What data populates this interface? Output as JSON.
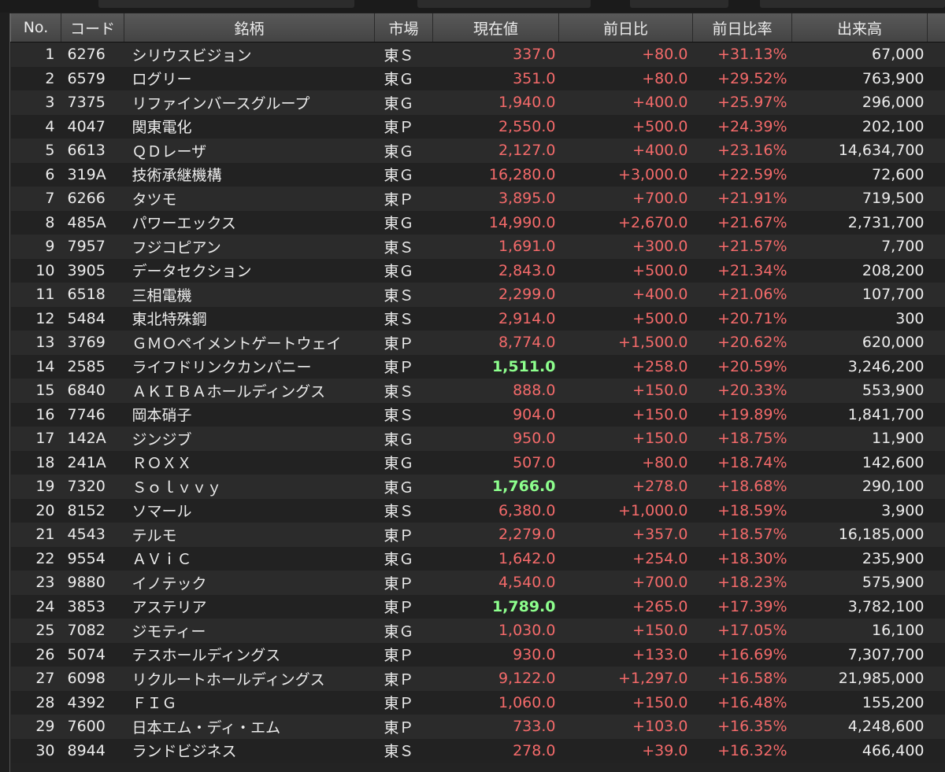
{
  "colors": {
    "up": "#f46a6a",
    "highlight_green": "#8dff8d",
    "text": "#ececec"
  },
  "table": {
    "headers": [
      "No.",
      "コード",
      "銘柄",
      "市場",
      "現在値",
      "前日比",
      "前日比率",
      "出来高"
    ],
    "rows": [
      {
        "no": "1",
        "code": "6276",
        "name": "シリウスビジョン",
        "market": "東Ｓ",
        "price": "337.0",
        "change": "+80.0",
        "pct": "+31.13%",
        "volume": "67,000",
        "price_color": "red"
      },
      {
        "no": "2",
        "code": "6579",
        "name": "ログリー",
        "market": "東Ｇ",
        "price": "351.0",
        "change": "+80.0",
        "pct": "+29.52%",
        "volume": "763,900",
        "price_color": "red"
      },
      {
        "no": "3",
        "code": "7375",
        "name": "リファインバースグループ",
        "market": "東Ｇ",
        "price": "1,940.0",
        "change": "+400.0",
        "pct": "+25.97%",
        "volume": "296,000",
        "price_color": "red"
      },
      {
        "no": "4",
        "code": "4047",
        "name": "関東電化",
        "market": "東Ｐ",
        "price": "2,550.0",
        "change": "+500.0",
        "pct": "+24.39%",
        "volume": "202,100",
        "price_color": "red"
      },
      {
        "no": "5",
        "code": "6613",
        "name": "ＱＤレーザ",
        "market": "東Ｇ",
        "price": "2,127.0",
        "change": "+400.0",
        "pct": "+23.16%",
        "volume": "14,634,700",
        "price_color": "red"
      },
      {
        "no": "6",
        "code": "319A",
        "name": "技術承継機構",
        "market": "東Ｇ",
        "price": "16,280.0",
        "change": "+3,000.0",
        "pct": "+22.59%",
        "volume": "72,600",
        "price_color": "red"
      },
      {
        "no": "7",
        "code": "6266",
        "name": "タツモ",
        "market": "東Ｐ",
        "price": "3,895.0",
        "change": "+700.0",
        "pct": "+21.91%",
        "volume": "719,500",
        "price_color": "red"
      },
      {
        "no": "8",
        "code": "485A",
        "name": "パワーエックス",
        "market": "東Ｇ",
        "price": "14,990.0",
        "change": "+2,670.0",
        "pct": "+21.67%",
        "volume": "2,731,700",
        "price_color": "red"
      },
      {
        "no": "9",
        "code": "7957",
        "name": "フジコピアン",
        "market": "東Ｓ",
        "price": "1,691.0",
        "change": "+300.0",
        "pct": "+21.57%",
        "volume": "7,700",
        "price_color": "red"
      },
      {
        "no": "10",
        "code": "3905",
        "name": "データセクション",
        "market": "東Ｇ",
        "price": "2,843.0",
        "change": "+500.0",
        "pct": "+21.34%",
        "volume": "208,200",
        "price_color": "red"
      },
      {
        "no": "11",
        "code": "6518",
        "name": "三相電機",
        "market": "東Ｓ",
        "price": "2,299.0",
        "change": "+400.0",
        "pct": "+21.06%",
        "volume": "107,700",
        "price_color": "red"
      },
      {
        "no": "12",
        "code": "5484",
        "name": "東北特殊鋼",
        "market": "東Ｓ",
        "price": "2,914.0",
        "change": "+500.0",
        "pct": "+20.71%",
        "volume": "300",
        "price_color": "red"
      },
      {
        "no": "13",
        "code": "3769",
        "name": "ＧＭＯペイメントゲートウェイ",
        "market": "東Ｐ",
        "price": "8,774.0",
        "change": "+1,500.0",
        "pct": "+20.62%",
        "volume": "620,000",
        "price_color": "red"
      },
      {
        "no": "14",
        "code": "2585",
        "name": "ライフドリンクカンパニー",
        "market": "東Ｐ",
        "price": "1,511.0",
        "change": "+258.0",
        "pct": "+20.59%",
        "volume": "3,246,200",
        "price_color": "green"
      },
      {
        "no": "15",
        "code": "6840",
        "name": "ＡＫＩＢＡホールディングス",
        "market": "東Ｓ",
        "price": "888.0",
        "change": "+150.0",
        "pct": "+20.33%",
        "volume": "553,900",
        "price_color": "red"
      },
      {
        "no": "16",
        "code": "7746",
        "name": "岡本硝子",
        "market": "東Ｓ",
        "price": "904.0",
        "change": "+150.0",
        "pct": "+19.89%",
        "volume": "1,841,700",
        "price_color": "red"
      },
      {
        "no": "17",
        "code": "142A",
        "name": "ジンジブ",
        "market": "東Ｇ",
        "price": "950.0",
        "change": "+150.0",
        "pct": "+18.75%",
        "volume": "11,900",
        "price_color": "red"
      },
      {
        "no": "18",
        "code": "241A",
        "name": "ＲＯＸＸ",
        "market": "東Ｇ",
        "price": "507.0",
        "change": "+80.0",
        "pct": "+18.74%",
        "volume": "142,600",
        "price_color": "red"
      },
      {
        "no": "19",
        "code": "7320",
        "name": "Ｓｏｌｖｖｙ",
        "market": "東Ｇ",
        "price": "1,766.0",
        "change": "+278.0",
        "pct": "+18.68%",
        "volume": "290,100",
        "price_color": "green"
      },
      {
        "no": "20",
        "code": "8152",
        "name": "ソマール",
        "market": "東Ｓ",
        "price": "6,380.0",
        "change": "+1,000.0",
        "pct": "+18.59%",
        "volume": "3,900",
        "price_color": "red"
      },
      {
        "no": "21",
        "code": "4543",
        "name": "テルモ",
        "market": "東Ｐ",
        "price": "2,279.0",
        "change": "+357.0",
        "pct": "+18.57%",
        "volume": "16,185,000",
        "price_color": "red"
      },
      {
        "no": "22",
        "code": "9554",
        "name": "ＡＶｉＣ",
        "market": "東Ｇ",
        "price": "1,642.0",
        "change": "+254.0",
        "pct": "+18.30%",
        "volume": "235,900",
        "price_color": "red"
      },
      {
        "no": "23",
        "code": "9880",
        "name": "イノテック",
        "market": "東Ｐ",
        "price": "4,540.0",
        "change": "+700.0",
        "pct": "+18.23%",
        "volume": "575,900",
        "price_color": "red"
      },
      {
        "no": "24",
        "code": "3853",
        "name": "アステリア",
        "market": "東Ｐ",
        "price": "1,789.0",
        "change": "+265.0",
        "pct": "+17.39%",
        "volume": "3,782,100",
        "price_color": "green"
      },
      {
        "no": "25",
        "code": "7082",
        "name": "ジモティー",
        "market": "東Ｇ",
        "price": "1,030.0",
        "change": "+150.0",
        "pct": "+17.05%",
        "volume": "16,100",
        "price_color": "red"
      },
      {
        "no": "26",
        "code": "5074",
        "name": "テスホールディングス",
        "market": "東Ｐ",
        "price": "930.0",
        "change": "+133.0",
        "pct": "+16.69%",
        "volume": "7,307,700",
        "price_color": "red"
      },
      {
        "no": "27",
        "code": "6098",
        "name": "リクルートホールディングス",
        "market": "東Ｐ",
        "price": "9,122.0",
        "change": "+1,297.0",
        "pct": "+16.58%",
        "volume": "21,985,000",
        "price_color": "red"
      },
      {
        "no": "28",
        "code": "4392",
        "name": "ＦＩＧ",
        "market": "東Ｐ",
        "price": "1,060.0",
        "change": "+150.0",
        "pct": "+16.48%",
        "volume": "155,200",
        "price_color": "red"
      },
      {
        "no": "29",
        "code": "7600",
        "name": "日本エム・ディ・エム",
        "market": "東Ｐ",
        "price": "733.0",
        "change": "+103.0",
        "pct": "+16.35%",
        "volume": "4,248,600",
        "price_color": "red"
      },
      {
        "no": "30",
        "code": "8944",
        "name": "ランドビジネス",
        "market": "東Ｓ",
        "price": "278.0",
        "change": "+39.0",
        "pct": "+16.32%",
        "volume": "466,400",
        "price_color": "red"
      }
    ]
  }
}
